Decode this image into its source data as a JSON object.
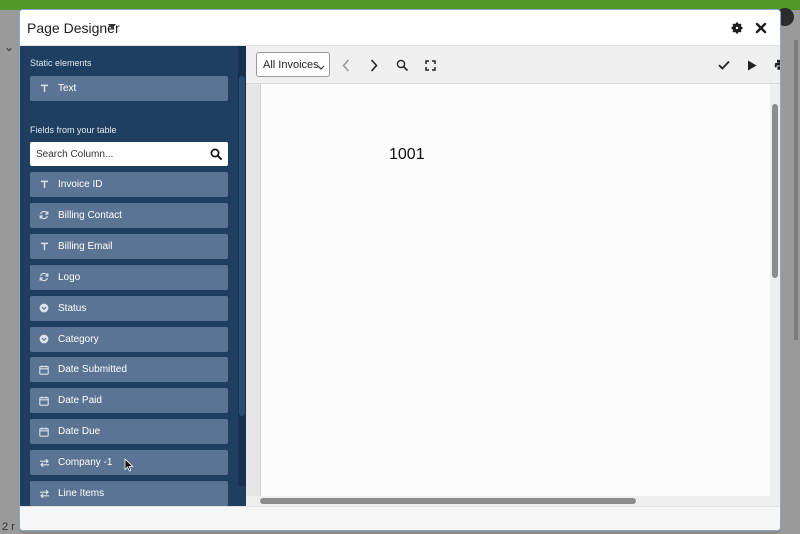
{
  "modal": {
    "title": "Page Designer"
  },
  "sidebar": {
    "static_section": "Static elements",
    "static_items": [
      {
        "label": "Text",
        "icon": "text-icon"
      }
    ],
    "fields_section": "Fields from your table",
    "search_placeholder": "Search Column...",
    "fields": [
      {
        "label": "Invoice ID",
        "icon": "text-icon"
      },
      {
        "label": "Billing Contact",
        "icon": "refresh-icon"
      },
      {
        "label": "Billing Email",
        "icon": "text-icon"
      },
      {
        "label": "Logo",
        "icon": "refresh-icon"
      },
      {
        "label": "Status",
        "icon": "chevron-circle-icon"
      },
      {
        "label": "Category",
        "icon": "chevron-circle-icon"
      },
      {
        "label": "Date Submitted",
        "icon": "calendar-icon"
      },
      {
        "label": "Date Paid",
        "icon": "calendar-icon"
      },
      {
        "label": "Date Due",
        "icon": "calendar-icon"
      },
      {
        "label": "Company -1",
        "icon": "link-arrows-icon"
      },
      {
        "label": "Line Items",
        "icon": "link-arrows-icon"
      }
    ]
  },
  "toolbar": {
    "record_select": "All Invoices"
  },
  "page": {
    "value": "1001"
  },
  "background": {
    "bottom_text": "2 r"
  },
  "colors": {
    "sidebar_bg": "#1f3f61",
    "item_bg": "#5b7494",
    "topbar_green": "#4f9a2a"
  }
}
